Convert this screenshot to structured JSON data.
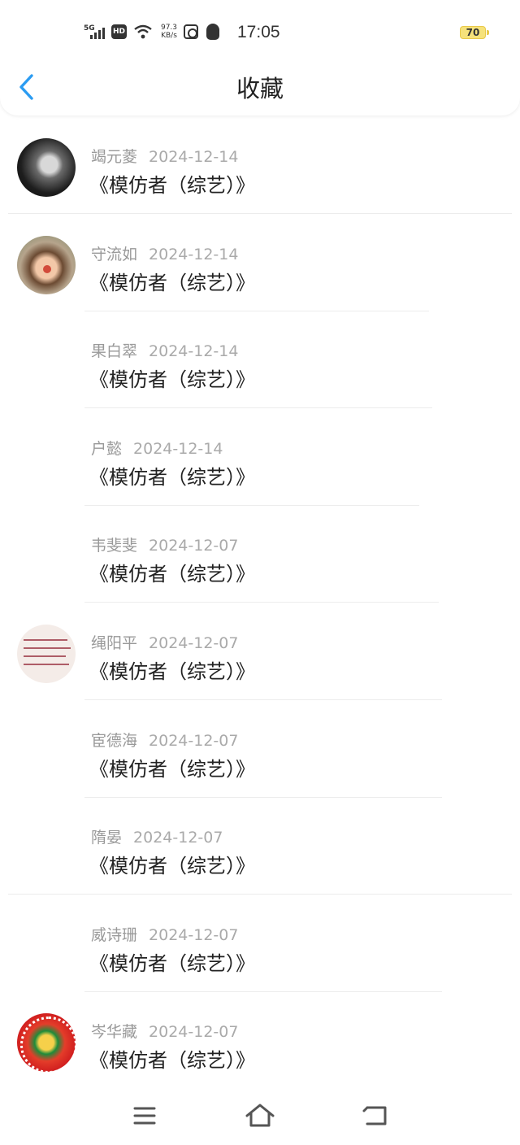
{
  "status_bar": {
    "network": "5G",
    "hd": "HD",
    "speed_value": "97.3",
    "speed_unit": "KB/s",
    "time": "17:05",
    "battery": "70"
  },
  "header": {
    "title": "收藏",
    "back_icon": "chevron-left-icon"
  },
  "colors": {
    "accent": "#2b9cf2",
    "title_text": "#222222",
    "meta_text": "#999999",
    "battery": "#f6e27a"
  },
  "favorites": [
    {
      "name": "竭元菱",
      "date": "2024-12-14",
      "title": "《模仿者（综艺）》"
    },
    {
      "name": "守流如",
      "date": "2024-12-14",
      "title": "《模仿者（综艺）》"
    },
    {
      "name": "果白翠",
      "date": "2024-12-14",
      "title": "《模仿者（综艺）》"
    },
    {
      "name": "户懿",
      "date": "2024-12-14",
      "title": "《模仿者（综艺）》"
    },
    {
      "name": "韦斐斐",
      "date": "2024-12-07",
      "title": "《模仿者（综艺）》"
    },
    {
      "name": "绳阳平",
      "date": "2024-12-07",
      "title": "《模仿者（综艺）》"
    },
    {
      "name": "宦德海",
      "date": "2024-12-07",
      "title": "《模仿者（综艺）》"
    },
    {
      "name": "隋晏",
      "date": "2024-12-07",
      "title": "《模仿者（综艺）》"
    },
    {
      "name": "威诗珊",
      "date": "2024-12-07",
      "title": "《模仿者（综艺）》"
    },
    {
      "name": "岑华藏",
      "date": "2024-12-07",
      "title": "《模仿者（综艺）》"
    }
  ],
  "navbar": {
    "menu_icon": "menu-icon",
    "home_icon": "home-icon",
    "back_icon": "back-arrow-icon"
  }
}
